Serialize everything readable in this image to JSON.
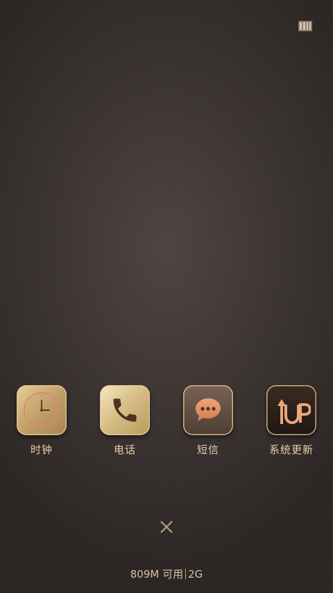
{
  "apps": [
    {
      "label": "时钟",
      "icon": "clock-icon"
    },
    {
      "label": "电话",
      "icon": "phone-icon"
    },
    {
      "label": "短信",
      "icon": "message-icon"
    },
    {
      "label": "系统更新",
      "icon": "system-update-icon"
    }
  ],
  "footer": {
    "memory_available": "809M 可用",
    "network": "2G"
  },
  "colors": {
    "label_text": "#e8cfa8",
    "gold_frame": "#e6c896",
    "background": "#3a3331"
  }
}
